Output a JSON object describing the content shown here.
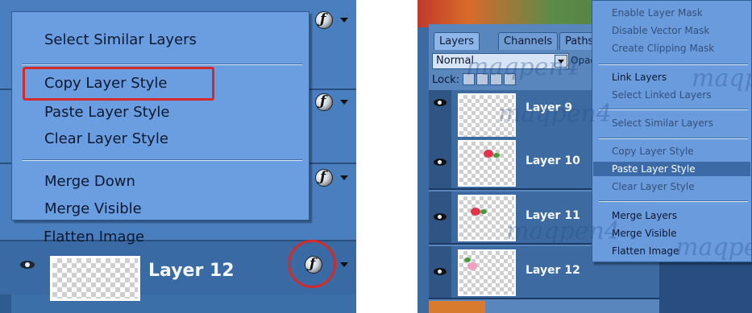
{
  "left_panel": {
    "context_menu": {
      "items": [
        {
          "label": "Select Similar Layers"
        },
        {
          "label": "Copy Layer Style"
        },
        {
          "label": "Paste Layer Style"
        },
        {
          "label": "Clear Layer Style"
        },
        {
          "label": "Merge Down"
        },
        {
          "label": "Merge Visible"
        },
        {
          "label": "Flatten Image"
        }
      ]
    },
    "layer": {
      "name": "Layer 12"
    },
    "highlight_color": "#d42a2a"
  },
  "right_panel": {
    "tabs": [
      {
        "label": "Layers"
      },
      {
        "label": "Channels"
      },
      {
        "label": "Paths"
      }
    ],
    "blend_mode": "Normal",
    "opacity_label": "Opaci",
    "lock_label": "Lock:",
    "layers": [
      {
        "name": "Layer 9"
      },
      {
        "name": "Layer 10"
      },
      {
        "name": "Layer 11"
      },
      {
        "name": "Layer 12"
      }
    ],
    "context_menu": {
      "items": [
        {
          "label": "Enable Layer Mask"
        },
        {
          "label": "Disable Vector Mask"
        },
        {
          "label": "Create Clipping Mask"
        },
        {
          "label": "Link Layers"
        },
        {
          "label": "Select Linked Layers"
        },
        {
          "label": "Select Similar Layers"
        },
        {
          "label": "Copy Layer Style"
        },
        {
          "label": "Paste Layer Style"
        },
        {
          "label": "Clear Layer Style"
        },
        {
          "label": "Merge Layers"
        },
        {
          "label": "Merge Visible"
        },
        {
          "label": "Flatten Image"
        }
      ],
      "highlighted_item": "Paste Layer Style"
    }
  },
  "watermark": "maqpen4"
}
